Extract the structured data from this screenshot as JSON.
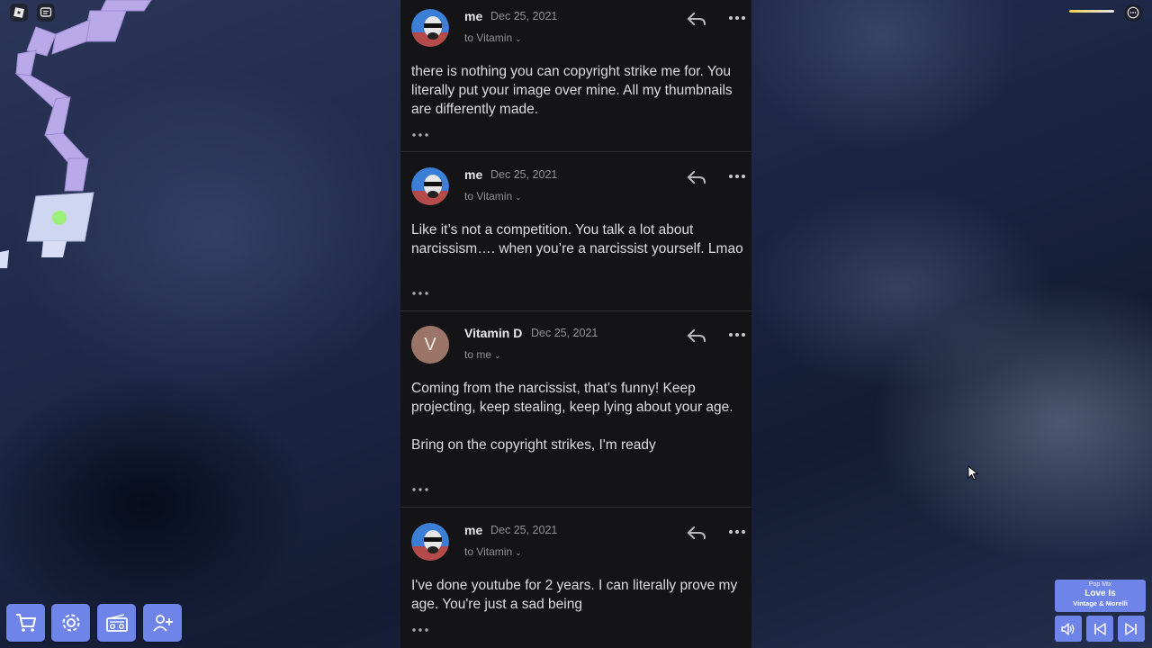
{
  "email": {
    "messages": [
      {
        "sender": "me",
        "date": "Dec 25, 2021",
        "to": "to Vitamin",
        "avatar": "user-avatar",
        "body": "there is nothing you can copyright strike me for. You literally put your image over mine. All my thumbnails are differently made."
      },
      {
        "sender": "me",
        "date": "Dec 25, 2021",
        "to": "to Vitamin",
        "avatar": "user-avatar",
        "body": "Like it’s not a competition. You talk a lot about narcissism…. when you’re a narcissist yourself. Lmao"
      },
      {
        "sender": "Vitamin D",
        "date": "Dec 25, 2021",
        "to": "to me",
        "avatar_letter": "V",
        "body": "Coming from the narcissist, that's funny! Keep projecting, keep stealing, keep lying about your age.\n\nBring on the copyright strikes, I'm ready"
      },
      {
        "sender": "me",
        "date": "Dec 25, 2021",
        "to": "to Vitamin",
        "avatar": "user-avatar",
        "body": "I've done youtube for 2 years. I can literally prove my age. You're just a sad being"
      }
    ]
  },
  "music_player": {
    "mix": "Pop Mix",
    "song": "Love Is",
    "artist": "Vintage & Morelli"
  },
  "hotbar": {
    "icons": [
      "cart-icon",
      "gear-icon",
      "radio-icon",
      "add-friend-icon"
    ]
  },
  "colors": {
    "panel_bg": "#141416",
    "hotbar_blue": "#6f84e8",
    "avatar_v": "#9a7568",
    "text_primary": "#dcdcdc",
    "text_muted": "#8f8f94"
  }
}
